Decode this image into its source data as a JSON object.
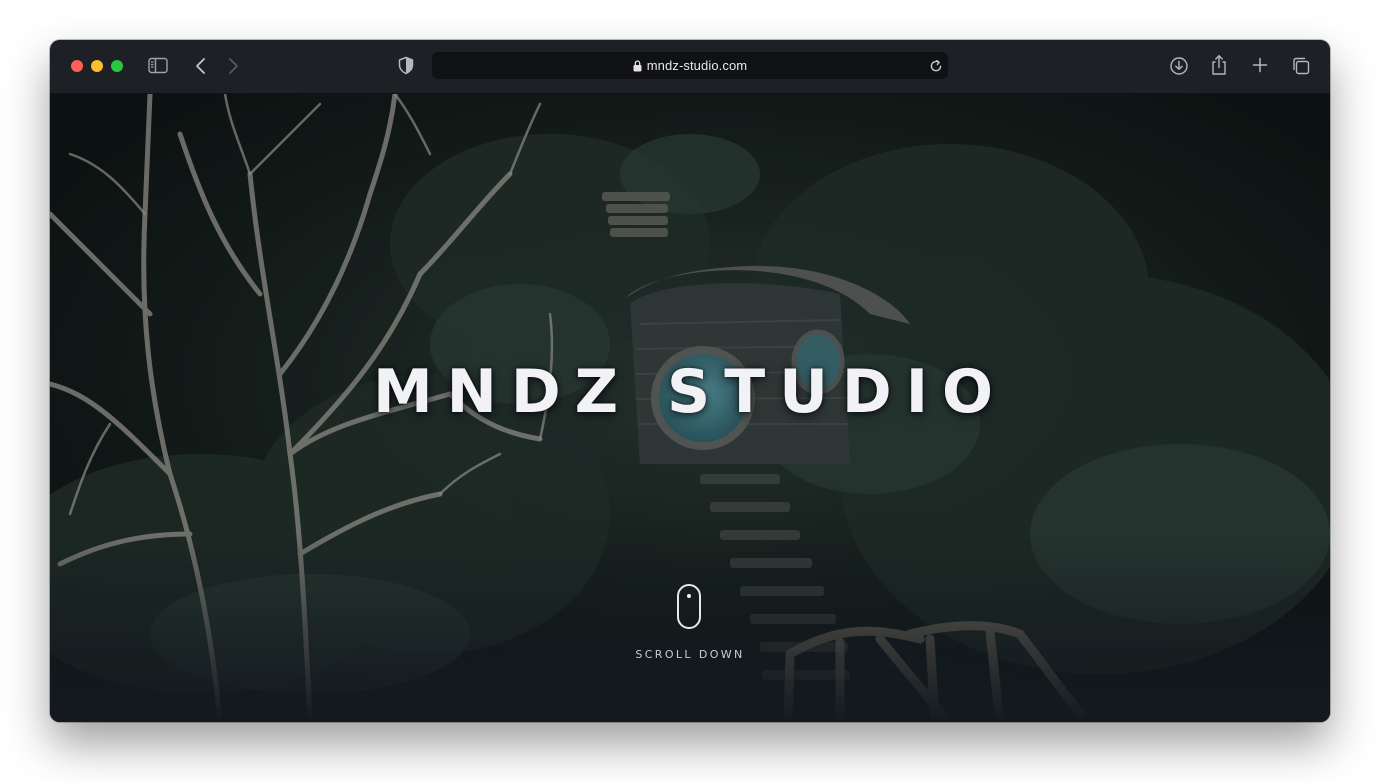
{
  "browser": {
    "url": "mndz-studio.com",
    "traffic_lights": {
      "close": "#ff5f57",
      "minimize": "#febc2e",
      "maximize": "#28c840"
    },
    "toolbar_color": "#1d2024"
  },
  "hero": {
    "title": "MNDZ STUDIO",
    "scroll_label": "SCROLL DOWN",
    "background_description_colors": [
      "#0e1512",
      "#1b2621",
      "#2a3a33",
      "#4a7b86"
    ]
  }
}
